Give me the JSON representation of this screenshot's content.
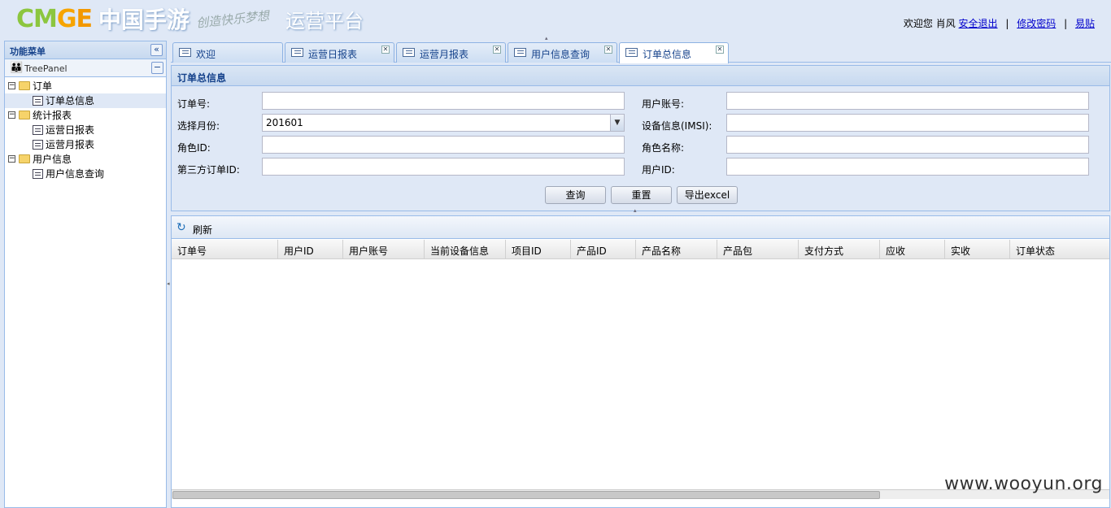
{
  "header": {
    "logo_cmge_1": "CM",
    "logo_cmge_2": "G",
    "logo_cmge_3": "E",
    "logo_cn": "中国手游",
    "logo_slogan": "创造快乐梦想",
    "title": "运营平台",
    "welcome": "欢迎您 肖风",
    "logout": "安全退出",
    "change_password": "修改密码",
    "yitie": "易贴",
    "separator": "|"
  },
  "west": {
    "title": "功能菜单",
    "treepanel_title": "TreePanel",
    "tree": [
      {
        "label": "订单",
        "type": "folder",
        "level": 0
      },
      {
        "label": "订单总信息",
        "type": "leaf",
        "level": 1,
        "selected": true
      },
      {
        "label": "统计报表",
        "type": "folder",
        "level": 0
      },
      {
        "label": "运营日报表",
        "type": "leaf",
        "level": 1
      },
      {
        "label": "运营月报表",
        "type": "leaf",
        "level": 1
      },
      {
        "label": "用户信息",
        "type": "folder",
        "level": 0
      },
      {
        "label": "用户信息查询",
        "type": "leaf",
        "level": 1
      }
    ]
  },
  "tabs": [
    {
      "label": "欢迎",
      "closable": false
    },
    {
      "label": "运营日报表",
      "closable": true
    },
    {
      "label": "运营月报表",
      "closable": true
    },
    {
      "label": "用户信息查询",
      "closable": true
    },
    {
      "label": "订单总信息",
      "closable": true,
      "active": true
    }
  ],
  "form": {
    "title": "订单总信息",
    "order_no_label": "订单号:",
    "order_no_value": "",
    "user_account_label": "用户账号:",
    "user_account_value": "",
    "month_label": "选择月份:",
    "month_value": "201601",
    "device_label": "设备信息(IMSI):",
    "device_value": "",
    "role_id_label": "角色ID:",
    "role_id_value": "",
    "role_name_label": "角色名称:",
    "role_name_value": "",
    "third_order_label": "第三方订单ID:",
    "third_order_value": "",
    "user_id_label": "用户ID:",
    "user_id_value": "",
    "query_btn": "查询",
    "reset_btn": "重置",
    "export_btn": "导出excel"
  },
  "grid": {
    "refresh_label": "刷新",
    "columns": [
      "订单号",
      "用户ID",
      "用户账号",
      "当前设备信息",
      "项目ID",
      "产品ID",
      "产品名称",
      "产品包",
      "支付方式",
      "应收",
      "实收",
      "订单状态"
    ]
  },
  "watermark": "www.wooyun.org"
}
